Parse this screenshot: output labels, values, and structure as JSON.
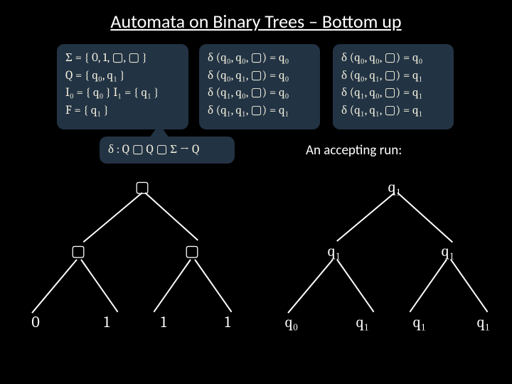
{
  "title": "Automata on Binary Trees – Bottom up",
  "defs": {
    "sigma": "Σ = { 0, 1, ▢, ▢ }",
    "Q": "Q = { q₀, q₁ }",
    "I": "I₀ = { q₀ }   I₁ = { q₁ }",
    "F": "F = { q₁ }"
  },
  "rules1": {
    "r1": "δ (q₀, q₀, ▢) = q₀",
    "r2": "δ (q₀, q₁, ▢) = q₀",
    "r3": "δ (q₁, q₀, ▢) = q₀",
    "r4": "δ (q₁, q₁, ▢) = q₁"
  },
  "rules2": {
    "r1": "δ (q₀, q₀, ▢) = q₀",
    "r2": "δ (q₀, q₁, ▢) = q₁",
    "r3": "δ (q₁, q₀, ▢) = q₁",
    "r4": "δ (q₁, q₁, ▢) = q₁"
  },
  "signature": "δ : Q ▢ Q ▢ Σ  → Q",
  "acceptingLabel": "An accepting run:",
  "tree1": {
    "root": "▢",
    "l": "▢",
    "r": "▢",
    "ll": "0",
    "lr": "1",
    "rl": "1",
    "rr": "1"
  },
  "tree2": {
    "root": "q₁",
    "l": "q₁",
    "r": "q₁",
    "ll": "q₀",
    "lr": "q₁",
    "rl": "q₁",
    "rr": "q₁"
  }
}
